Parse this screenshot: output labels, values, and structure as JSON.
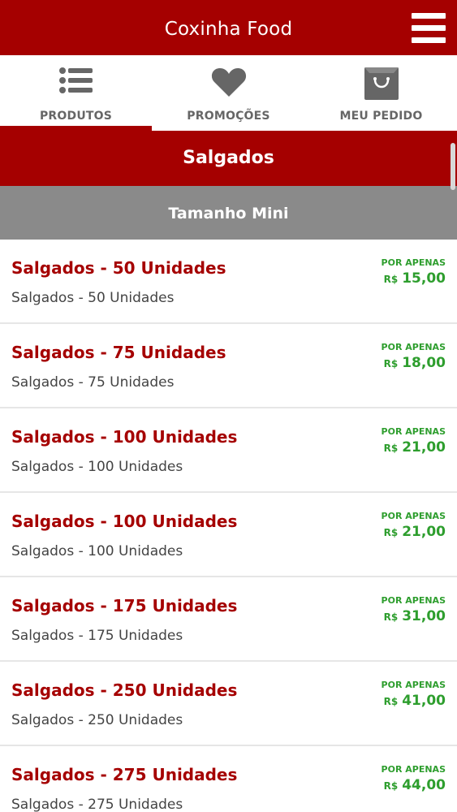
{
  "app": {
    "title": "Coxinha Food",
    "brand_color": "#a50000"
  },
  "tabs": [
    {
      "label": "PRODUTOS",
      "icon": "list-icon",
      "active": true
    },
    {
      "label": "PROMOÇÕES",
      "icon": "heart-icon",
      "active": false
    },
    {
      "label": "MEU PEDIDO",
      "icon": "shopping-bag-icon",
      "active": false
    }
  ],
  "section": {
    "title": "Salgados",
    "subtitle": "Tamanho Mini"
  },
  "products": [
    {
      "name": "Salgados - 50 Unidades",
      "description": "Salgados - 50 Unidades",
      "price_label": "POR APENAS",
      "currency": "R$",
      "price": "15,00"
    },
    {
      "name": "Salgados - 75 Unidades",
      "description": "Salgados - 75 Unidades",
      "price_label": "POR APENAS",
      "currency": "R$",
      "price": "18,00"
    },
    {
      "name": "Salgados - 100 Unidades",
      "description": "Salgados - 100 Unidades",
      "price_label": "POR APENAS",
      "currency": "R$",
      "price": "21,00"
    },
    {
      "name": "Salgados - 100 Unidades",
      "description": "Salgados - 100 Unidades",
      "price_label": "POR APENAS",
      "currency": "R$",
      "price": "21,00"
    },
    {
      "name": "Salgados - 175 Unidades",
      "description": "Salgados - 175 Unidades",
      "price_label": "POR APENAS",
      "currency": "R$",
      "price": "31,00"
    },
    {
      "name": "Salgados - 250 Unidades",
      "description": "Salgados - 250 Unidades",
      "price_label": "POR APENAS",
      "currency": "R$",
      "price": "41,00"
    },
    {
      "name": "Salgados - 275 Unidades",
      "description": "Salgados - 275 Unidades",
      "price_label": "POR APENAS",
      "currency": "R$",
      "price": "44,00"
    }
  ],
  "colors": {
    "header": "#a50000",
    "subheader": "#8a8a8a",
    "price": "#2e9e2e",
    "product_name": "#a50000"
  }
}
